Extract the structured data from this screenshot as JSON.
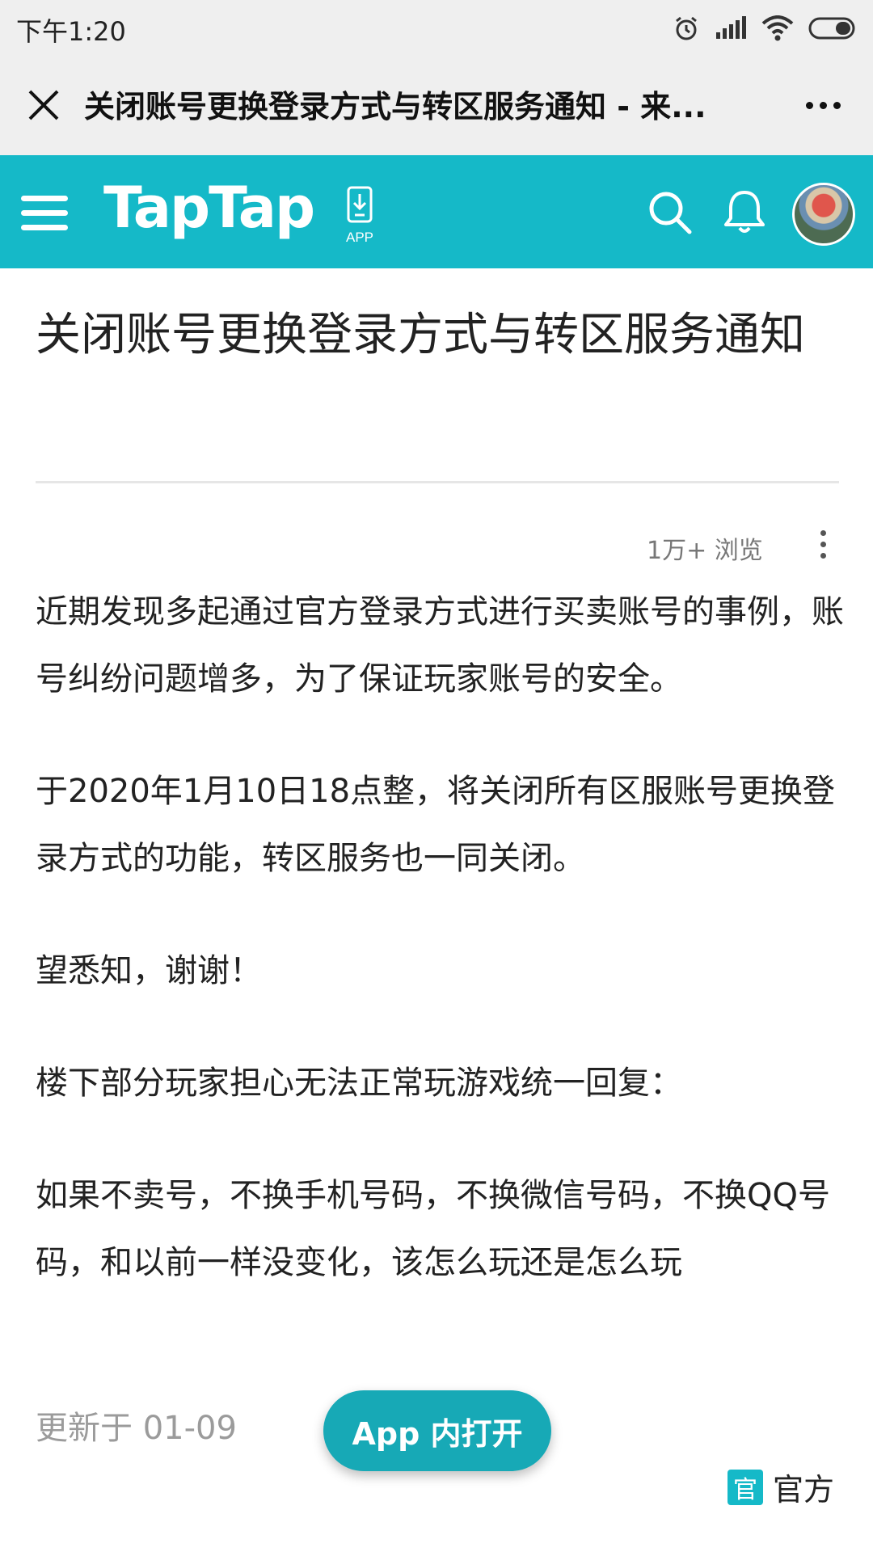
{
  "status_bar": {
    "time": "下午1:20",
    "icons": [
      "alarm-icon",
      "signal-icon",
      "wifi-icon",
      "battery-icon"
    ]
  },
  "browser": {
    "title": "关闭账号更换登录方式与转区服务通知 - 来...",
    "close_icon": "close-icon",
    "more_icon": "more-icon"
  },
  "navbar": {
    "brand": "TapTap",
    "app_label": "APP",
    "accent": "#15b9c8"
  },
  "article": {
    "title": "关闭账号更换登录方式与转区服务通知",
    "views": "1万+ 浏览",
    "paragraphs": [
      "近期发现多起通过官方登录方式进行买卖账号的事例，账号纠纷问题增多，为了保证玩家账号的安全。",
      "于2020年1月10日18点整，将关闭所有区服账号更换登录方式的功能，转区服务也一同关闭。",
      "望悉知，谢谢！",
      "楼下部分玩家担心无法正常玩游戏统一回复：",
      "如果不卖号，不换手机号码，不换微信号码，不换QQ号码，和以前一样没变化，该怎么玩还是怎么玩"
    ],
    "updated": "更新于 01-09"
  },
  "actions": {
    "open_in_app": "App 内打开"
  },
  "author": {
    "badge": "官",
    "label": "官方"
  }
}
